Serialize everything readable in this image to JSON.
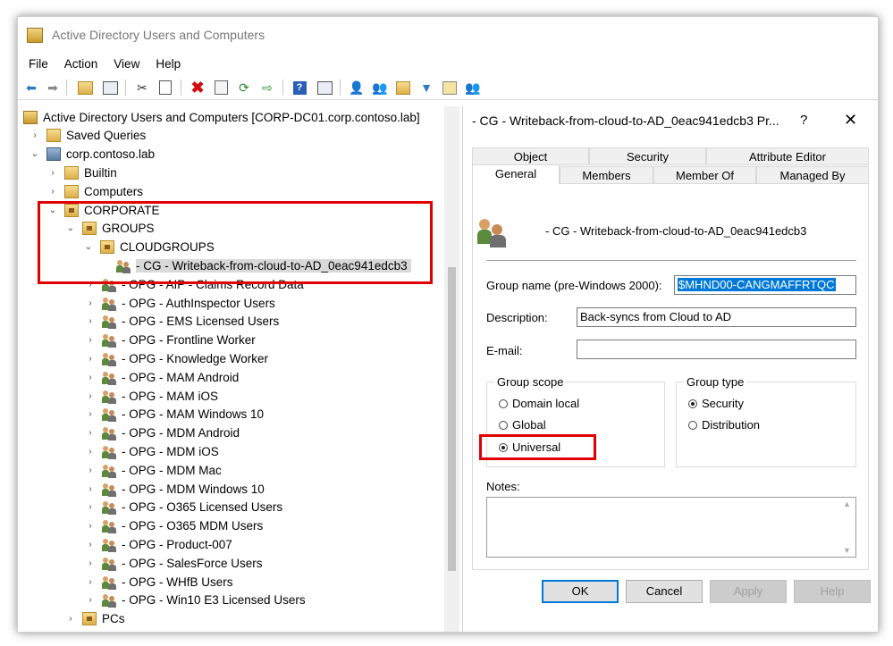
{
  "window": {
    "title": "Active Directory Users and Computers"
  },
  "menu": [
    "File",
    "Action",
    "View",
    "Help"
  ],
  "toolbar_icons": [
    "back-arrow-icon",
    "forward-arrow-icon",
    "folder-up-icon",
    "console-tree-icon",
    "cut-icon",
    "copy-icon",
    "delete-icon",
    "properties-icon",
    "refresh-icon",
    "export-icon",
    "help-icon",
    "show-icon",
    "user-icon",
    "group-icon",
    "ou-icon",
    "filter-icon",
    "find-icon",
    "add-member-icon"
  ],
  "tree": [
    {
      "label": "Active Directory Users and Computers [CORP-DC01.corp.contoso.lab]",
      "level": 0,
      "icon": "book",
      "exp": ""
    },
    {
      "label": "Saved Queries",
      "level": 1,
      "icon": "folder",
      "exp": "›"
    },
    {
      "label": "corp.contoso.lab",
      "level": 1,
      "icon": "domain",
      "exp": "⌄"
    },
    {
      "label": "Builtin",
      "level": 2,
      "icon": "folder",
      "exp": "›"
    },
    {
      "label": "Computers",
      "level": 2,
      "icon": "folder",
      "exp": "›"
    },
    {
      "label": "CORPORATE",
      "level": 2,
      "icon": "ou",
      "exp": "⌄"
    },
    {
      "label": "GROUPS",
      "level": 3,
      "icon": "ou",
      "exp": "⌄"
    },
    {
      "label": "CLOUDGROUPS",
      "level": 4,
      "icon": "ou",
      "exp": "⌄"
    },
    {
      "label": "- CG - Writeback-from-cloud-to-AD_0eac941edcb3",
      "level": 5,
      "icon": "group",
      "exp": "",
      "selected": true
    },
    {
      "label": "- OPG - AIP - Claims Record Data",
      "level": 4,
      "icon": "group",
      "exp": "›"
    },
    {
      "label": "- OPG - AuthInspector Users",
      "level": 4,
      "icon": "group",
      "exp": "›"
    },
    {
      "label": "- OPG - EMS Licensed Users",
      "level": 4,
      "icon": "group",
      "exp": "›"
    },
    {
      "label": "- OPG - Frontline Worker",
      "level": 4,
      "icon": "group",
      "exp": "›"
    },
    {
      "label": "- OPG - Knowledge Worker",
      "level": 4,
      "icon": "group",
      "exp": "›"
    },
    {
      "label": "- OPG - MAM Android",
      "level": 4,
      "icon": "group",
      "exp": "›"
    },
    {
      "label": "- OPG - MAM iOS",
      "level": 4,
      "icon": "group",
      "exp": "›"
    },
    {
      "label": "- OPG - MAM Windows 10",
      "level": 4,
      "icon": "group",
      "exp": "›"
    },
    {
      "label": "- OPG - MDM Android",
      "level": 4,
      "icon": "group",
      "exp": "›"
    },
    {
      "label": "- OPG - MDM iOS",
      "level": 4,
      "icon": "group",
      "exp": "›"
    },
    {
      "label": "- OPG - MDM Mac",
      "level": 4,
      "icon": "group",
      "exp": "›"
    },
    {
      "label": "- OPG - MDM Windows 10",
      "level": 4,
      "icon": "group",
      "exp": "›"
    },
    {
      "label": "- OPG - O365 Licensed Users",
      "level": 4,
      "icon": "group",
      "exp": "›"
    },
    {
      "label": "- OPG - O365 MDM Users",
      "level": 4,
      "icon": "group",
      "exp": "›"
    },
    {
      "label": "- OPG - Product-007",
      "level": 4,
      "icon": "group",
      "exp": "›"
    },
    {
      "label": "- OPG - SalesForce Users",
      "level": 4,
      "icon": "group",
      "exp": "›"
    },
    {
      "label": "- OPG - WHfB Users",
      "level": 4,
      "icon": "group",
      "exp": "›"
    },
    {
      "label": "- OPG - Win10 E3 Licensed Users",
      "level": 4,
      "icon": "group",
      "exp": "›"
    },
    {
      "label": "PCs",
      "level": 3,
      "icon": "ou",
      "exp": "›"
    }
  ],
  "dialog": {
    "title": "- CG - Writeback-from-cloud-to-AD_0eac941edcb3 Pr...",
    "help": "?",
    "close": "✕",
    "tabs_top": [
      "Object",
      "Security",
      "Attribute Editor"
    ],
    "tabs_bottom": [
      "General",
      "Members",
      "Member Of",
      "Managed By"
    ],
    "active_tab": "General",
    "group_display": "- CG - Writeback-from-cloud-to-AD_0eac941edcb3",
    "group_name_label": "Group name (pre-Windows 2000):",
    "group_name_value": "$MHND00-CANGMAFFRTQC",
    "description_label": "Description:",
    "description_value": "Back-syncs from Cloud to AD",
    "email_label": "E-mail:",
    "email_value": "",
    "scope_label": "Group scope",
    "scope_options": [
      {
        "label": "Domain local",
        "selected": false
      },
      {
        "label": "Global",
        "selected": false
      },
      {
        "label": "Universal",
        "selected": true
      }
    ],
    "type_label": "Group type",
    "type_options": [
      {
        "label": "Security",
        "selected": true
      },
      {
        "label": "Distribution",
        "selected": false
      }
    ],
    "notes_label": "Notes:",
    "notes_value": "",
    "buttons": {
      "ok": "OK",
      "cancel": "Cancel",
      "apply": "Apply",
      "help": "Help"
    }
  }
}
